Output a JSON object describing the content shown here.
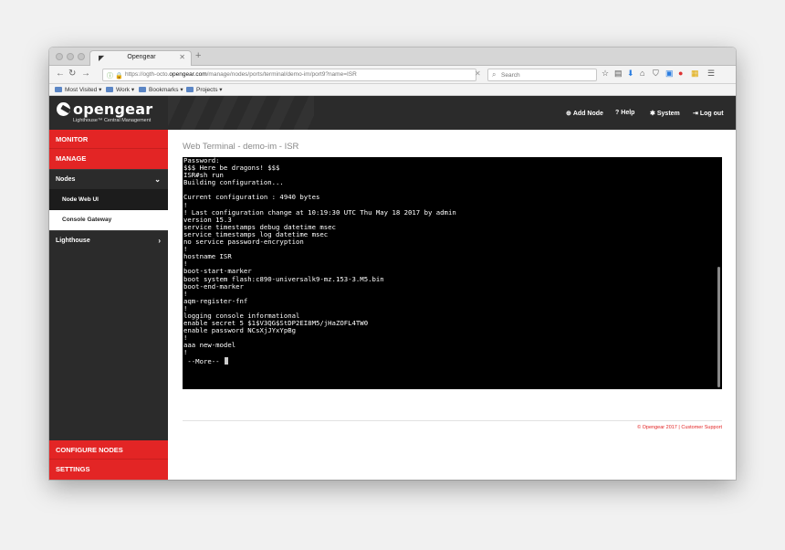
{
  "browser": {
    "tab_title": "Opengear",
    "url_prefix": "https://ogth-octo.",
    "url_domain": "opengear.com",
    "url_path": "/manage/nodes/ports/terminal/demo-im/port9?name=ISR",
    "search_placeholder": "Search",
    "bookmarks": [
      {
        "label": "Most Visited ▾"
      },
      {
        "label": "Work ▾"
      },
      {
        "label": "Bookmarks ▾"
      },
      {
        "label": "Projects ▾"
      }
    ]
  },
  "header": {
    "logo": "opengear",
    "tagline": "Lighthouse™ Central Management",
    "add_node": "Add Node",
    "help": "Help",
    "system": "System",
    "logout": "Log out"
  },
  "sidebar": {
    "monitor": "MONITOR",
    "manage": "MANAGE",
    "nodes": "Nodes",
    "node_web_ui": "Node Web UI",
    "console_gateway": "Console Gateway",
    "lighthouse": "Lighthouse",
    "configure_nodes": "CONFIGURE NODES",
    "settings": "SETTINGS"
  },
  "main": {
    "title": "Web Terminal - demo-im - ISR",
    "terminal_lines": [
      "Password:",
      "$$$ Here be dragons! $$$",
      "ISR#sh run",
      "Building configuration...",
      "",
      "Current configuration : 4940 bytes",
      "!",
      "! Last configuration change at 10:19:30 UTC Thu May 18 2017 by admin",
      "version 15.3",
      "service timestamps debug datetime msec",
      "service timestamps log datetime msec",
      "no service password-encryption",
      "!",
      "hostname ISR",
      "!",
      "boot-start-marker",
      "boot system flash:c890-universalk9-mz.153-3.M5.bin",
      "boot-end-marker",
      "!",
      "aqm-register-fnf",
      "!",
      "logging console informational",
      "enable secret 5 $1$V3QG$StDP2EI8M5/jHaZOFL4TW0",
      "enable password NCsXjJYxYpBg",
      "!",
      "aaa new-model",
      "!"
    ],
    "more_prompt": " --More-- ",
    "footer": "© Opengear 2017 | Customer Support"
  },
  "colors": {
    "brand_red": "#e32525",
    "header_dark": "#2b2b2b",
    "terminal_bg": "#000000"
  }
}
